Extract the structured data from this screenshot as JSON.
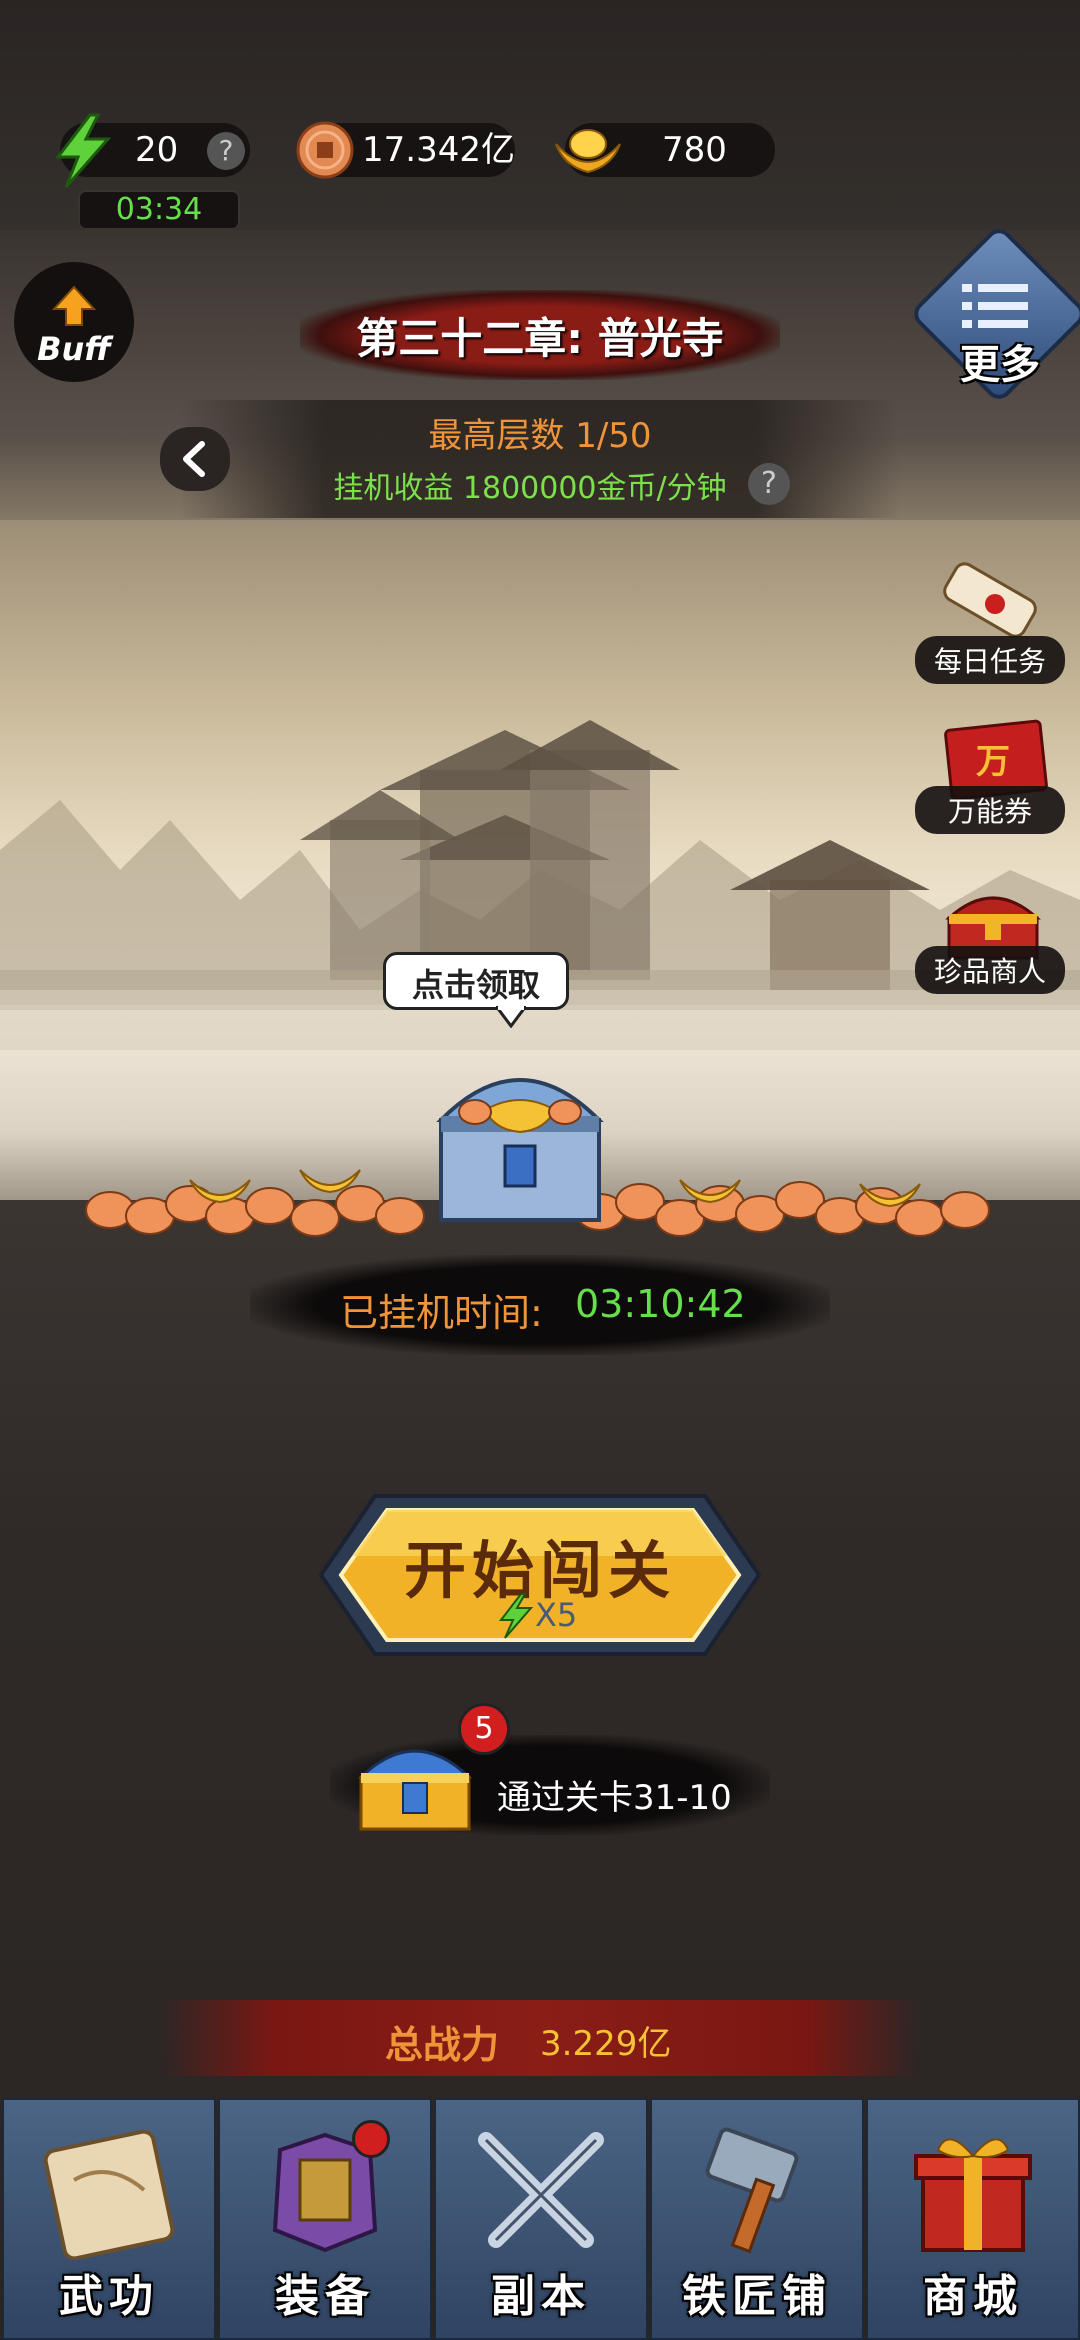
{
  "top_bar": {
    "energy": "20",
    "energy_timer": "03:34",
    "copper": "17.342亿",
    "gold": "780",
    "help_glyph": "?"
  },
  "buff_button": {
    "label": "Buff"
  },
  "more_button": {
    "label": "更多"
  },
  "chapter": {
    "title": "第三十二章: 普光寺",
    "max_floor": "最高层数 1/50",
    "idle_income": "挂机收益 1800000金币/分钟"
  },
  "side_menu": [
    {
      "label": "每日任务",
      "icon": "scroll-icon"
    },
    {
      "label": "万能券",
      "icon": "voucher-icon",
      "badge_text": "万"
    },
    {
      "label": "珍品商人",
      "icon": "treasure-chest-icon"
    }
  ],
  "treasure": {
    "tooltip": "点击领取",
    "idle_time_label": "已挂机时间:",
    "idle_time_value": "03:10:42"
  },
  "start_button": {
    "label": "开始闯关",
    "cost": "X5"
  },
  "reward": {
    "badge": "5",
    "text": "通过关卡31-10"
  },
  "power": {
    "label": "总战力",
    "value": "3.229亿"
  },
  "nav": [
    {
      "label": "武功",
      "icon": "scroll-map-icon",
      "badge": false
    },
    {
      "label": "装备",
      "icon": "armor-icon",
      "badge": true
    },
    {
      "label": "副本",
      "icon": "crossed-swords-icon",
      "badge": false
    },
    {
      "label": "铁匠铺",
      "icon": "hammer-icon",
      "badge": false
    },
    {
      "label": "商城",
      "icon": "gift-box-icon",
      "badge": false
    }
  ],
  "colors": {
    "accent_gold": "#f6c235",
    "timer_green": "#66e04a",
    "income_green": "#7be04a",
    "floor_orange": "#f0943a",
    "nav_blue": "#3e5676",
    "badge_red": "#d11f1f"
  }
}
